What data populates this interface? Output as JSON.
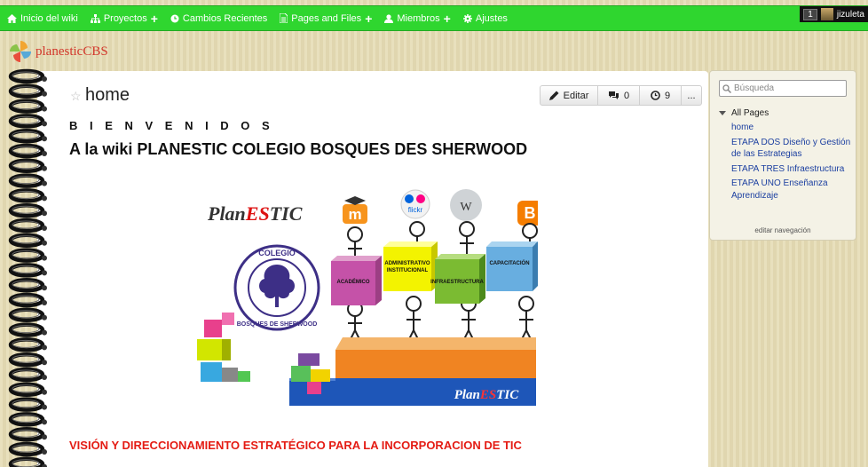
{
  "topbar": {
    "nav": [
      {
        "label": "Inicio del wiki",
        "icon": "home-icon",
        "plus": false
      },
      {
        "label": "Proyectos",
        "icon": "sitemap-icon",
        "plus": true
      },
      {
        "label": "Cambios Recientes",
        "icon": "clock-icon",
        "plus": false
      },
      {
        "label": "Pages and Files",
        "icon": "file-icon",
        "plus": true
      },
      {
        "label": "Miembros",
        "icon": "user-icon",
        "plus": true
      },
      {
        "label": "Ajustes",
        "icon": "gear-icon",
        "plus": false
      }
    ],
    "user": {
      "count": "1",
      "name": "jizuleta"
    }
  },
  "logo": {
    "name": "planesticCBS"
  },
  "page": {
    "title": "home",
    "actions": {
      "edit": "Editar",
      "comments": "0",
      "history": "9",
      "more": "..."
    },
    "welcome": "B I E N V E N I D O S",
    "heading": "A la wiki PLANESTIC COLEGIO BOSQUES DES SHERWOOD",
    "vision": "VISIÓN Y DIRECCIONAMIENTO ESTRATÉGICO PARA LA INCORPORACION DE TIC"
  },
  "banner": {
    "brand": "PlanESTIC",
    "seal_top": "COLEGIO",
    "seal_bottom": "BOSQUES DE SHERWOOD",
    "blocks": [
      "ACADÉMICO",
      "ADMINISTRATIVO INSTITUCIONAL",
      "INFRAESTRUCTURA",
      "CAPACITACIÓN"
    ],
    "blocks_lines": [
      [
        "ACADÉMICO"
      ],
      [
        "ADMINISTRATIVO",
        "INSTITUCIONAL"
      ],
      [
        "INFRAESTRUCTURA"
      ],
      [
        "CAPACITACIÓN"
      ]
    ],
    "flickr": "flickr",
    "brand_bottom": "PlanESTIC"
  },
  "sidebar": {
    "search_placeholder": "Búsqueda",
    "all_pages": "All Pages",
    "pages": [
      "home",
      "ETAPA DOS Diseño y Gestión de las Estrategias",
      "ETAPA TRES Infraestructura",
      "ETAPA UNO Enseñanza Aprendizaje"
    ],
    "edit_nav": "editar navegación"
  },
  "colors": {
    "topbar": "#2fd62f",
    "link": "#1b3fa0",
    "vision": "#e41c14",
    "logo": "#d2362a"
  }
}
